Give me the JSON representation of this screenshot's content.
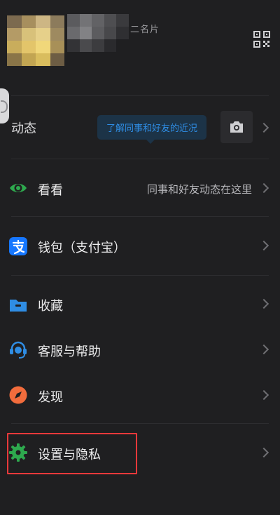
{
  "profile": {
    "name_tail": "二名片",
    "qr_icon": "qr-code-icon"
  },
  "dynamic": {
    "label": "动态",
    "tooltip": "了解同事和好友的近况",
    "camera_icon": "camera-icon"
  },
  "menu": [
    {
      "key": "watch",
      "label": "看看",
      "hint": "同事和好友动态在这里",
      "icon": "eye-icon",
      "color": "#2ea94e"
    },
    {
      "key": "wallet",
      "label": "钱包（支付宝）",
      "hint": "",
      "icon": "alipay-icon",
      "color": "#1677ff"
    },
    {
      "key": "favorites",
      "label": "收藏",
      "hint": "",
      "icon": "folder-icon",
      "color": "#2f8de4"
    },
    {
      "key": "support",
      "label": "客服与帮助",
      "hint": "",
      "icon": "headset-icon",
      "color": "#2f8de4"
    },
    {
      "key": "discover",
      "label": "发现",
      "hint": "",
      "icon": "compass-icon",
      "color": "#f26c3c"
    },
    {
      "key": "settings",
      "label": "设置与隐私",
      "hint": "",
      "icon": "gear-icon",
      "color": "#2ea94e"
    }
  ],
  "colors": {
    "background": "#1f1f21",
    "highlight_border": "#e8393b",
    "tooltip_text": "#2f8de4"
  }
}
